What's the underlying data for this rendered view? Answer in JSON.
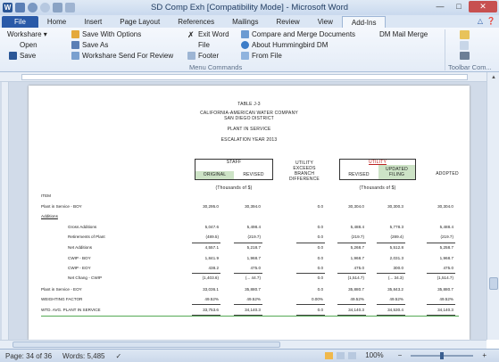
{
  "window": {
    "title": "SD Comp Exh [Compatibility Mode] - Microsoft Word",
    "app_icon": "W",
    "controls": [
      "minimize-icon",
      "maximize-icon",
      "close-icon"
    ]
  },
  "ribbon_tabs": [
    "File",
    "Home",
    "Insert",
    "Page Layout",
    "References",
    "Mailings",
    "Review",
    "View",
    "Add-Ins"
  ],
  "active_tab": "Add-Ins",
  "ribbon": {
    "worksharer": "Workshare ▾",
    "save_with_options": "Save With Options",
    "exit_word": "Exit Word",
    "compare_merge": "Compare and Merge Documents",
    "dm_mail_merge": "DM Mail Merge",
    "open": "Open",
    "save_as": "Save As",
    "file": "File",
    "about": "About Hummingbird DM",
    "save": "Save",
    "send_for_review": "Workshare Send For Review",
    "footer": "Footer",
    "from_file": "From File",
    "group_menu": "Menu Commands",
    "group_toolbar": "Toolbar Com..."
  },
  "document": {
    "table_no": "TABLE J-3",
    "company": "CALIFORNIA-AMERICAN WATER COMPANY",
    "district": "SAN DIEGO DISTRICT",
    "subject": "PLANT IN SERVICE",
    "escalation": "ESCALATION YEAR 2013",
    "staff_header": "STAFF",
    "utility_header": "UTILITY",
    "col_original": "ORIGINAL",
    "col_revised": "REVISED",
    "col_exceeds": "UTILITY EXCEEDS BRANCH DIFFERENCE",
    "col_revised2": "REVISED",
    "col_updated": "UPDATED FILING",
    "col_adopted": "ADOPTED",
    "units_staff": "(Thousands of $)",
    "units_utility": "(Thousands of $)",
    "item_label": "ITEM",
    "rows": [
      {
        "label": "Plant in Service - BOY",
        "v": [
          "30,295.0",
          "30,394.0",
          "0.0",
          "30,304.0",
          "30,300.3",
          "30,304.0"
        ]
      },
      {
        "label": "Additions",
        "v": [
          "",
          "",
          "",
          "",
          "",
          ""
        ]
      },
      {
        "label": "Gross Additions",
        "v": [
          "5,047.6",
          "5,498.4",
          "0.0",
          "5,488.4",
          "5,778.3",
          "5,488.4"
        ]
      },
      {
        "label": "Retirements of Plant",
        "v": [
          "(489.5)",
          "(219.7)",
          "0.0",
          "(219.7)",
          "(289.4)",
          "(219.7)"
        ]
      },
      {
        "label": "Net Additions",
        "v": [
          "4,557.1",
          "5,218.7",
          "0.0",
          "5,268.7",
          "5,512.8",
          "5,258.7"
        ]
      },
      {
        "label": "CWIP - BOY",
        "v": [
          "1,841.9",
          "1,968.7",
          "0.0",
          "1,968.7",
          "2,031.3",
          "1,968.7"
        ]
      },
      {
        "label": "CWIP - EOY",
        "v": [
          "438.2",
          "475.0",
          "0.0",
          "475.0",
          "300.0",
          "475.0"
        ]
      },
      {
        "label": "Net Chang - CWIP",
        "v": [
          "(1,403.6)",
          "(... 44.7)",
          "0.0",
          "(1,514.7)",
          "(... 34.3)",
          "(1,514.7)"
        ]
      },
      {
        "label": "Plant in Service - EOY",
        "v": [
          "33,036.1",
          "35,880.7",
          "0.0",
          "35,880.7",
          "35,843.2",
          "35,880.7"
        ]
      },
      {
        "label": "WEIGHTING FACTOR",
        "v": [
          "49.52%",
          "49.52%",
          "0.00%",
          "49.52%",
          "49.52%",
          "49.52%"
        ]
      },
      {
        "label": "WTD. AVG. PLANT IN SERVICE",
        "v": [
          "33,753.6",
          "34,140.3",
          "0.0",
          "34,140.3",
          "34,530.4",
          "34,140.3"
        ]
      }
    ]
  },
  "status": {
    "page": "Page: 34 of 36",
    "words": "Words: 5,485",
    "zoom": "100%"
  }
}
